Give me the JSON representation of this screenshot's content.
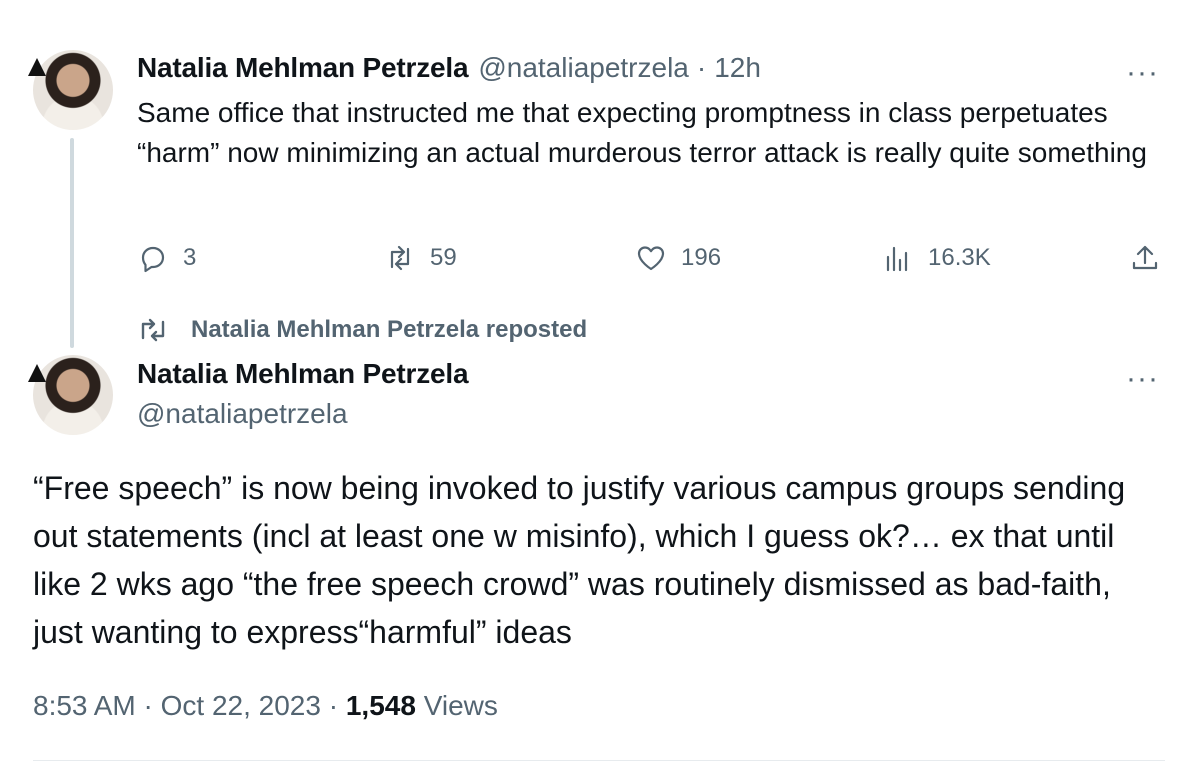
{
  "reply_tweet": {
    "author_name": "Natalia Mehlman Petrzela",
    "handle": "@nataliapetrzela",
    "separator": "·",
    "time": "12h",
    "text": "Same office that instructed me that expecting promptness in class perpetuates “harm” now minimizing an actual murderous terror attack is really quite something",
    "more_label": "···",
    "actions": {
      "reply_count": "3",
      "repost_count": "59",
      "like_count": "196",
      "views_count": "16.3K"
    }
  },
  "repost_context": {
    "label": "Natalia Mehlman Petrzela reposted"
  },
  "main_tweet": {
    "author_name": "Natalia Mehlman Petrzela",
    "handle": "@nataliapetrzela",
    "more_label": "···",
    "text": "“Free speech” is now being invoked to justify various campus groups sending out statements (incl at least one w misinfo), which I guess ok?… ex that until like 2 wks ago “the free speech crowd” was routinely dismissed as bad-faith, just wanting to express“harmful” ideas",
    "time": "8:53 AM",
    "date": "Oct 22, 2023",
    "views_count": "1,548",
    "views_label": "Views",
    "dot": "·"
  },
  "colors": {
    "text": "#0f1419",
    "muted": "#536471",
    "thread_line": "#cfd9de",
    "divider": "#e7ebee"
  },
  "icons": [
    "reply-icon",
    "repost-icon",
    "like-icon",
    "views-icon",
    "share-icon",
    "more-icon"
  ]
}
